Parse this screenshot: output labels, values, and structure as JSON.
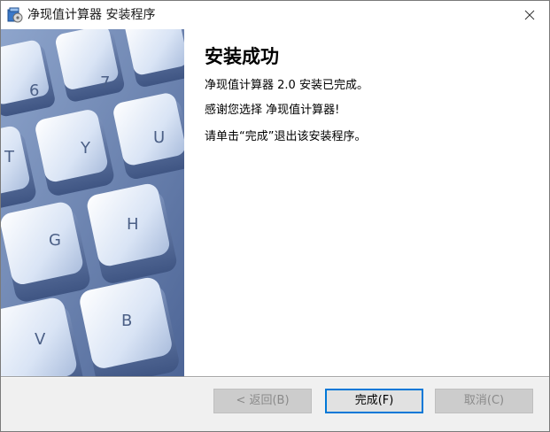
{
  "window": {
    "title": "净现值计算器 安装程序"
  },
  "content": {
    "heading": "安装成功",
    "line1": "净现值计算器 2.0 安装已完成。",
    "line2": "感谢您选择 净现值计算器!",
    "line3": "请单击“完成”退出该安装程序。"
  },
  "buttons": {
    "back": "< 返回(B)",
    "finish": "完成(F)",
    "cancel": "取消(C)"
  },
  "keyboard_keys": [
    "6",
    "7",
    "T",
    "Y",
    "U",
    "G",
    "H",
    "V",
    "B"
  ],
  "colors": {
    "accent": "#0078d7",
    "banner": "#6d86b2"
  }
}
